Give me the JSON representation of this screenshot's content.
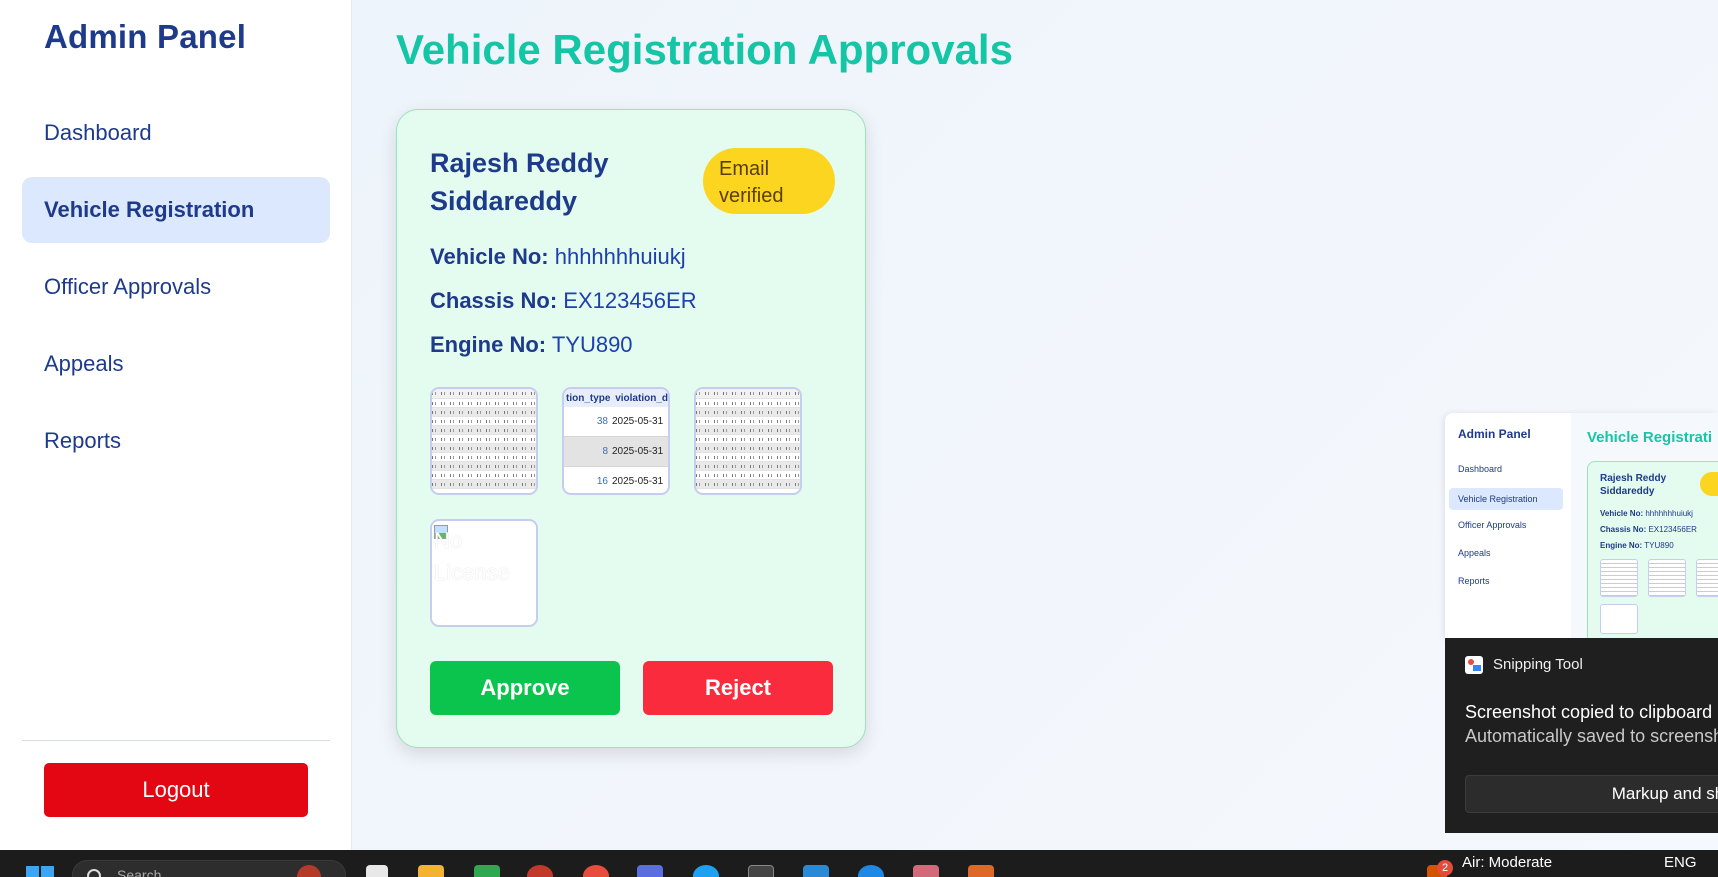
{
  "sidebar": {
    "brand": "Admin Panel",
    "items": [
      {
        "label": "Dashboard",
        "active": false
      },
      {
        "label": "Vehicle Registration",
        "active": true
      },
      {
        "label": "Officer Approvals",
        "active": false
      },
      {
        "label": "Appeals",
        "active": false
      },
      {
        "label": "Reports",
        "active": false
      }
    ],
    "logout_label": "Logout"
  },
  "main": {
    "title": "Vehicle Registration Approvals",
    "card": {
      "name": "Rajesh Reddy Siddareddy",
      "status_badge": "Email verified",
      "vehicle_no_label": "Vehicle No:",
      "vehicle_no": "hhhhhhhuiukj",
      "chassis_no_label": "Chassis No:",
      "chassis_no": "EX123456ER",
      "engine_no_label": "Engine No:",
      "engine_no": "TYU890",
      "doc2": {
        "headers": [
          "tion_type",
          "violation_d"
        ],
        "rows": [
          {
            "num": "38",
            "date": "2025-05-31"
          },
          {
            "num": "8",
            "date": "2025-05-31"
          },
          {
            "num": "16",
            "date": "2025-05-31"
          }
        ]
      },
      "license_alt": "No License",
      "approve_label": "Approve",
      "reject_label": "Reject"
    }
  },
  "preview": {
    "brand": "Admin Panel",
    "items": [
      "Dashboard",
      "Vehicle Registration",
      "Officer Approvals",
      "Appeals",
      "Reports"
    ],
    "title": "Vehicle Registrati",
    "name": "Rajesh Reddy Siddareddy",
    "vehicle_label": "Vehicle No:",
    "vehicle_value": "hhhhhhhuiukj",
    "chassis_label": "Chassis No:",
    "chassis_value": "EX123456ER",
    "engine_label": "Engine No:",
    "engine_value": "TYU890"
  },
  "toast": {
    "app": "Snipping Tool",
    "title": "Screenshot copied to clipboard",
    "subtitle": "Automatically saved to screensho",
    "action": "Markup and sh"
  },
  "taskbar": {
    "search_placeholder": "Search",
    "weather": "Air: Moderate",
    "weather_badge": "2",
    "language": "ENG"
  },
  "colors": {
    "accent_title": "#15c6a6",
    "brand_navy": "#1e3a8a",
    "approve": "#0bc44d",
    "reject": "#fa2b3d",
    "logout": "#e30613",
    "badge": "#fbd51f"
  }
}
